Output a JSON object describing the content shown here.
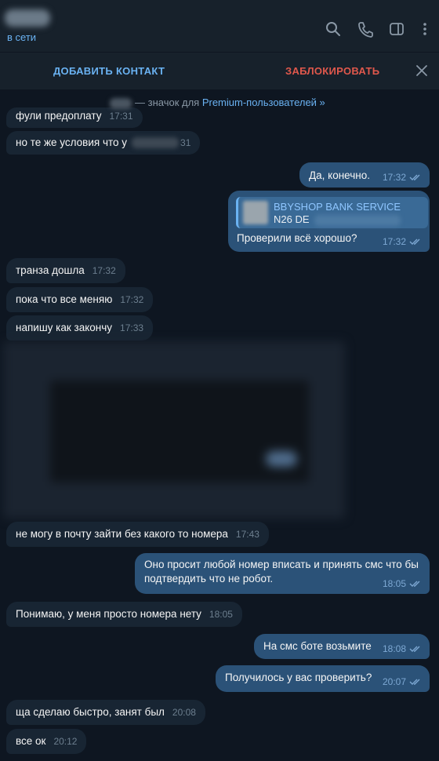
{
  "header": {
    "status": "в сети",
    "icons": [
      "search-icon",
      "phone-icon",
      "sidebar-icon",
      "more-icon"
    ]
  },
  "actionbar": {
    "add_contact": "ДОБАВИТЬ КОНТАКТ",
    "block": "ЗАБЛОКИРОВАТЬ"
  },
  "premium_note": {
    "text": "— значок для ",
    "link": "Premium-пользователей »"
  },
  "messages": [
    {
      "dir": "in",
      "text": "фули предоплату",
      "time": "17:31"
    },
    {
      "dir": "in",
      "text": "но те же условия что у",
      "time": "31"
    },
    {
      "dir": "out",
      "text": "Да, конечно.",
      "time": "17:32"
    },
    {
      "dir": "out",
      "reply_title": "BBYSHOP BANK SERVICE",
      "reply_sub": "N26 DE",
      "text": "Проверили всё хорошо?",
      "time": "17:32"
    },
    {
      "dir": "in",
      "text": "транза дошла",
      "time": "17:32"
    },
    {
      "dir": "in",
      "text": "пока что все меняю",
      "time": "17:32"
    },
    {
      "dir": "in",
      "text": "напишу как закончу",
      "time": "17:33"
    },
    {
      "dir": "in",
      "text": "не могу в почту зайти без какого то номера",
      "time": "17:43"
    },
    {
      "dir": "out",
      "text_line1": "Оно просит любой номер вписать и принять смс что бы",
      "text_line2": "подтвердить что не робот.",
      "time": "18:05"
    },
    {
      "dir": "in",
      "text": "Понимаю, у меня просто номера нету",
      "time": "18:05"
    },
    {
      "dir": "out",
      "text": "На смс боте возьмите",
      "time": "18:08"
    },
    {
      "dir": "out",
      "text": "Получилось у вас проверить?",
      "time": "20:07"
    },
    {
      "dir": "in",
      "text": "ща сделаю быстро, занят был",
      "time": "20:08"
    },
    {
      "dir": "in",
      "text": "все ок",
      "time": "20:12"
    }
  ],
  "colors": {
    "background": "#0e1621",
    "header": "#17212b",
    "incoming": "#182533",
    "outgoing": "#2b5278",
    "accent": "#6ab2f2",
    "danger": "#e0584c"
  }
}
